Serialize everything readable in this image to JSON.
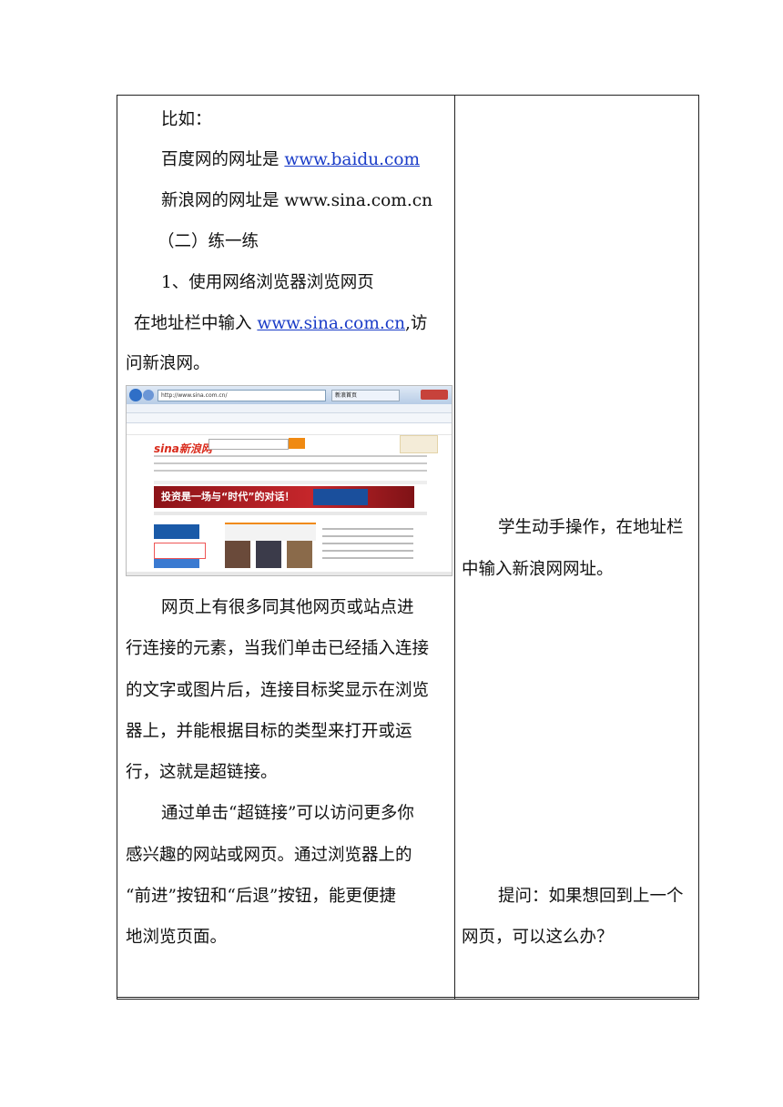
{
  "left_column": {
    "line1": "比如：",
    "line2_prefix": "百度网的网址是 ",
    "line2_link": "www.baidu.com",
    "line3": "新浪网的网址是 www.sina.com.cn",
    "line4": "（二）练一练",
    "line5": "1、使用网络浏览器浏览网页",
    "line6_prefix": "在地址栏中输入 ",
    "line6_link": "www.sina.com.cn",
    "line6_suffix": ",访",
    "line7": "问新浪网。",
    "para1": [
      "网页上有很多同其他网页或站点进",
      "行连接的元素，当我们单击已经插入连接",
      "的文字或图片后，连接目标奖显示在浏览",
      "器上，并能根据目标的类型来打开或运",
      "行，这就是超链接。"
    ],
    "para2": [
      "通过单击“超链接”可以访问更多你",
      "感兴趣的网站或网页。通过浏览器上的",
      "“前进”按钮和“后退”按钮，能更便捷",
      "地浏览页面。"
    ]
  },
  "right_column": {
    "note1": [
      "学生动手操作，在地址栏",
      "中输入新浪网网址。"
    ],
    "note2": [
      "提问：如果想回到上一个",
      "网页，可以这么办？"
    ]
  },
  "screenshot": {
    "address": "http://www.sina.com.cn/",
    "tab_title": "新浪首页",
    "logo": "sina新浪网",
    "banner_text": "投资是一场与“时代”的对话！"
  }
}
